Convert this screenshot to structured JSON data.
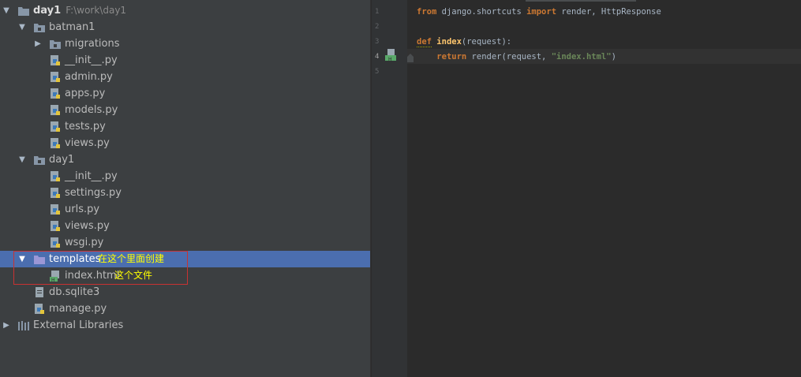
{
  "project": {
    "root_name": "day1",
    "root_path": "F:\\work\\day1",
    "tree": [
      {
        "label": "batman1",
        "kind": "package",
        "icon": "folder-icon"
      },
      {
        "label": "migrations",
        "kind": "folder",
        "icon": "folder-icon"
      },
      {
        "label": "__init__.py",
        "kind": "file",
        "icon": "python-file-icon"
      },
      {
        "label": "admin.py",
        "kind": "file",
        "icon": "python-file-icon"
      },
      {
        "label": "apps.py",
        "kind": "file",
        "icon": "python-file-icon"
      },
      {
        "label": "models.py",
        "kind": "file",
        "icon": "python-file-icon"
      },
      {
        "label": "tests.py",
        "kind": "file",
        "icon": "python-file-icon"
      },
      {
        "label": "views.py",
        "kind": "file",
        "icon": "python-file-icon"
      },
      {
        "label": "day1",
        "kind": "package",
        "icon": "folder-icon"
      },
      {
        "label": "__init__.py",
        "kind": "file",
        "icon": "python-file-icon"
      },
      {
        "label": "settings.py",
        "kind": "file",
        "icon": "python-file-icon"
      },
      {
        "label": "urls.py",
        "kind": "file",
        "icon": "python-file-icon"
      },
      {
        "label": "views.py",
        "kind": "file",
        "icon": "python-file-icon"
      },
      {
        "label": "wsgi.py",
        "kind": "file",
        "icon": "python-file-icon"
      },
      {
        "label": "templates",
        "kind": "folder",
        "icon": "folder-icon",
        "annotation": "在这个里面创建"
      },
      {
        "label": "index.html",
        "kind": "file",
        "icon": "html-file-icon",
        "annotation": "这个文件"
      },
      {
        "label": "db.sqlite3",
        "kind": "file",
        "icon": "database-file-icon"
      },
      {
        "label": "manage.py",
        "kind": "file",
        "icon": "python-file-icon"
      },
      {
        "label": "External Libraries",
        "kind": "library",
        "icon": "library-icon"
      }
    ]
  },
  "editor": {
    "line_numbers": [
      "1",
      "2",
      "3",
      "4",
      "5"
    ],
    "line1": {
      "kw1": "from",
      "mod": " django.shortcuts ",
      "kw2": "import",
      "names": " render, HttpResponse"
    },
    "line3": {
      "kw": "def",
      "name": "index",
      "params": "(request):"
    },
    "line4": {
      "kw": "return",
      "call": " render(request, ",
      "str": "\"index.html\"",
      "close": ")"
    }
  },
  "colors": {
    "tree_bg": "#3c3f41",
    "selection": "#4b6eaf",
    "annotation_text": "#ffff00",
    "annotation_border": "#c83232",
    "editor_bg": "#2b2b2b",
    "keyword": "#cc7832",
    "function": "#ffc66d",
    "string": "#6a8759"
  }
}
